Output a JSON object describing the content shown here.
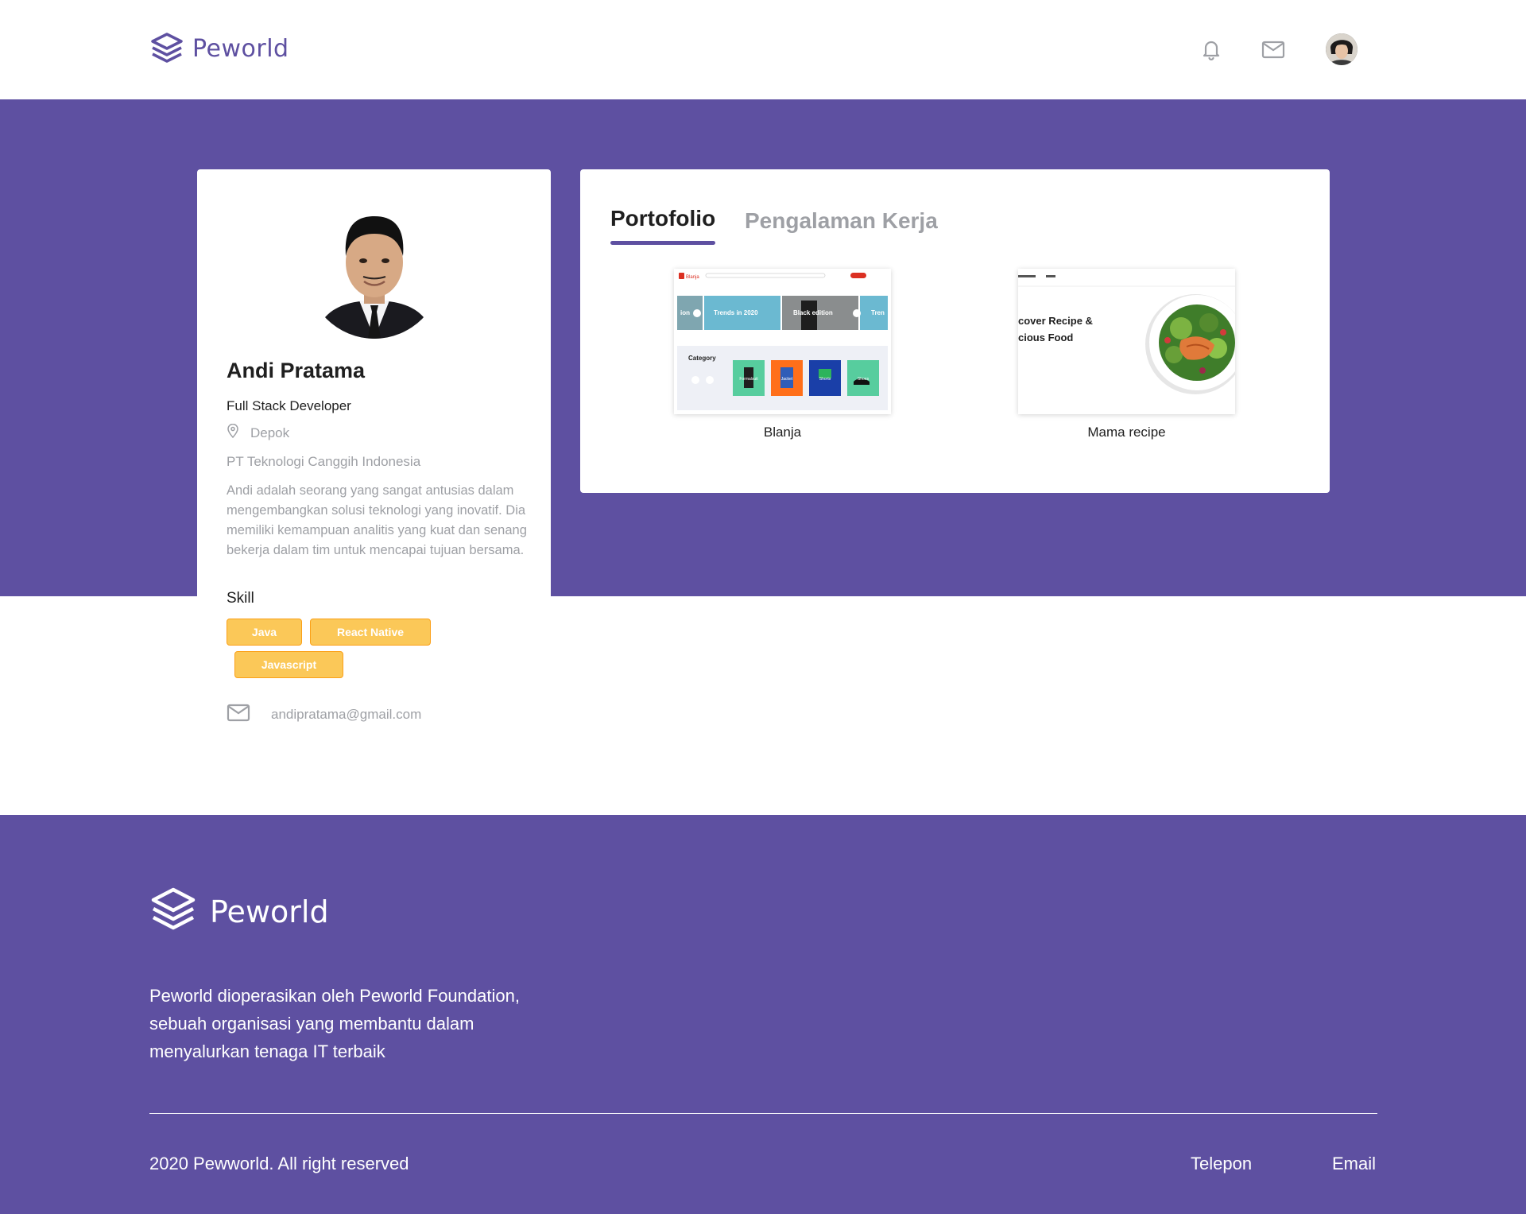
{
  "brand": {
    "name": "Peworld",
    "accent_color": "#5e50a1"
  },
  "navbar": {
    "icons": [
      "bell-icon",
      "mail-icon"
    ],
    "avatar": "user-avatar"
  },
  "profile": {
    "name": "Andi Pratama",
    "job_title": "Full Stack Developer",
    "location": "Depok",
    "company": "PT Teknologi Canggih Indonesia",
    "bio": "Andi adalah seorang yang sangat antusias dalam mengembangkan solusi teknologi yang inovatif. Dia memiliki kemampuan analitis yang kuat dan senang bekerja dalam tim untuk mencapai tujuan bersama.",
    "skill_title": "Skill",
    "skills": [
      "Java",
      "React Native",
      "Javascript"
    ],
    "skill_color": "#fbc858",
    "email": "andipratama@gmail.com"
  },
  "tabs": {
    "portfolio": "Portofolio",
    "experience": "Pengalaman Kerja",
    "active": "Portofolio"
  },
  "portfolio": {
    "items": [
      {
        "label": "Blanja",
        "thumb": {
          "app": "Blanja",
          "banners": [
            "ion",
            "Trends in 2020",
            "Black edition",
            "Tren"
          ],
          "category_title": "Category",
          "categories": [
            "Formalsuit",
            "Jacket",
            "Shorts",
            "Shoes"
          ]
        }
      },
      {
        "label": "Mama recipe",
        "thumb": {
          "headline_line1": "cover Recipe &",
          "headline_line2": "cious Food"
        }
      }
    ]
  },
  "footer": {
    "brand": "Peworld",
    "description": "Peworld dioperasikan oleh Peworld Foundation, sebuah organisasi yang membantu dalam menyalurkan tenaga IT terbaik",
    "copyright": "2020 Pewworld. All right reserved",
    "links": {
      "phone": "Telepon",
      "email": "Email"
    }
  }
}
